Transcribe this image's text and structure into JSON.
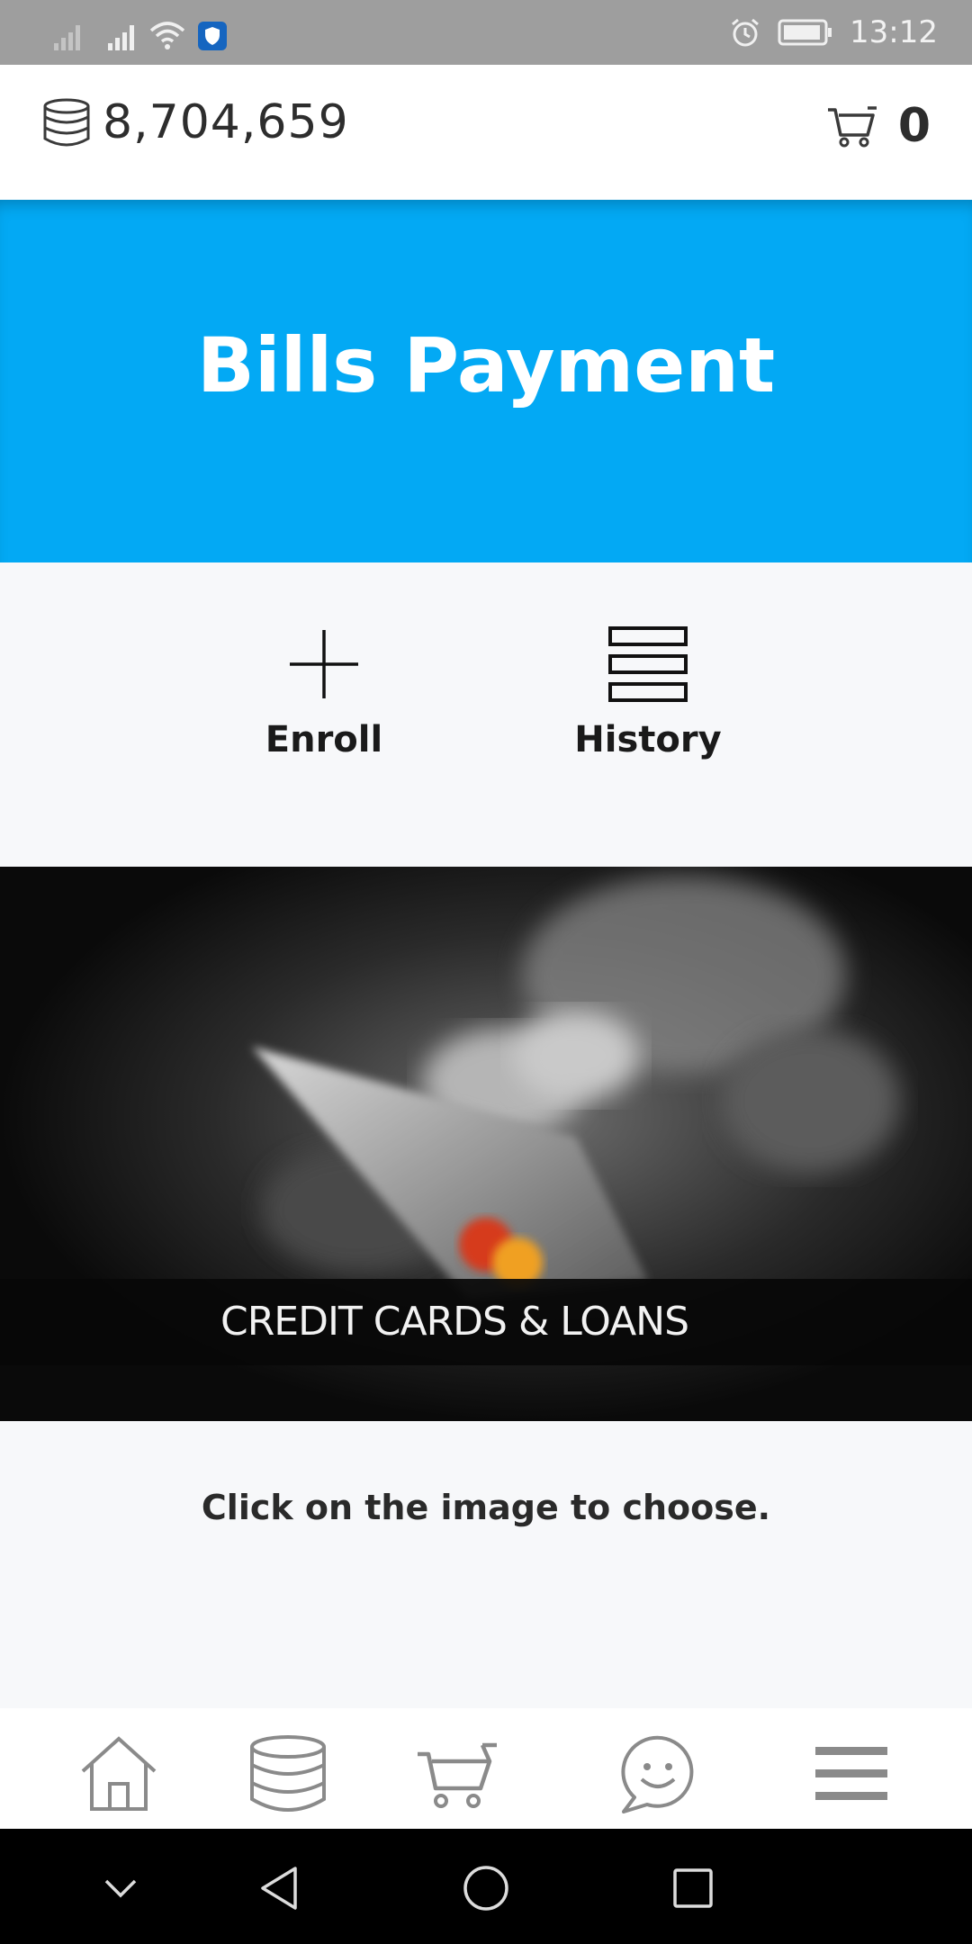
{
  "status_bar": {
    "time": "13:12",
    "icons": [
      "signal-icon",
      "signal-icon",
      "wifi-icon",
      "shield-icon",
      "alarm-icon",
      "battery-icon"
    ],
    "bar_color": "#9e9e9e"
  },
  "header": {
    "balance": "8,704,659",
    "cart_count": "0",
    "coin_icon": "coins-stack-icon",
    "cart_icon": "cart-icon"
  },
  "hero": {
    "title": "Bills Payment",
    "color": "#03a9f4"
  },
  "actions": [
    {
      "label": "Enroll",
      "icon": "plus-icon"
    },
    {
      "label": "History",
      "icon": "list-icon"
    }
  ],
  "category": {
    "label": "CREDIT CARDS & LOANS",
    "image": "hand-holding-credit-card-photo"
  },
  "hint": "Click on the image to choose.",
  "bottom_nav": {
    "items": [
      "home-icon",
      "coins-stack-icon",
      "cart-icon",
      "chat-smiley-icon",
      "menu-icon"
    ],
    "icon_color": "#8a8a8a"
  },
  "system_nav": {
    "items": [
      "chevron-down-icon",
      "back-icon",
      "home-circle-icon",
      "recents-icon"
    ]
  }
}
